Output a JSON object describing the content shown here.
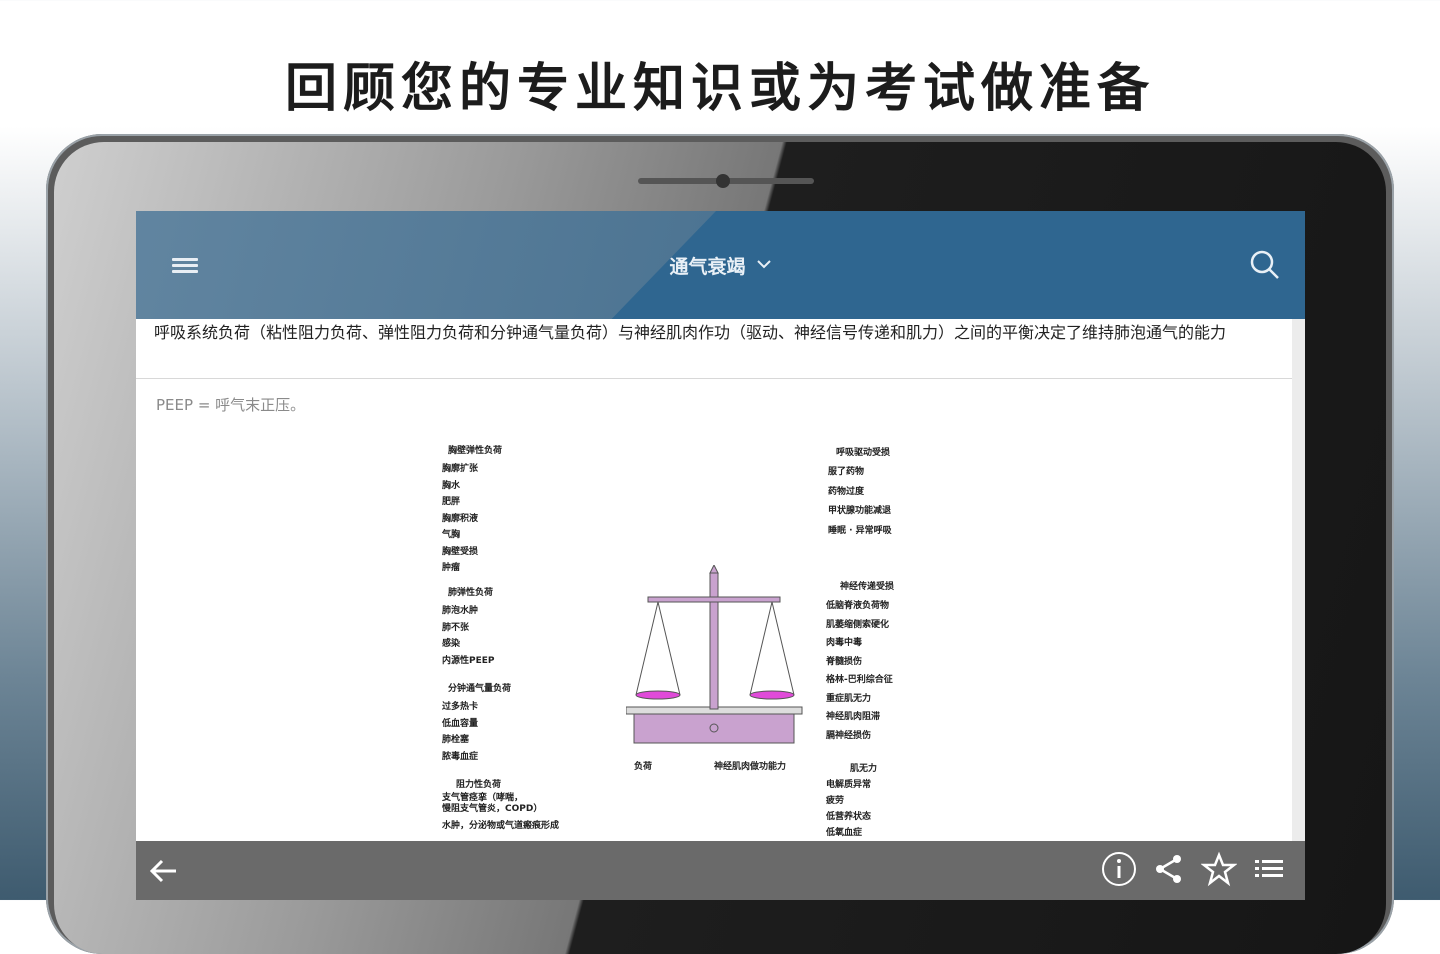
{
  "headline": "回顾您的专业知识或为考试做准备",
  "appbar": {
    "title": "通气衰竭",
    "menu_icon": "hamburger-menu-icon",
    "search_icon": "search-icon"
  },
  "summary": {
    "text": "呼吸系统负荷（粘性阻力负荷、弹性阻力负荷和分钟通气量负荷）与神经肌肉作功（驱动、神经信号传递和肌力）之间的平衡决定了维持肺泡通气的能力"
  },
  "note": "PEEP = 呼气末正压。",
  "figure": {
    "left_groups": [
      {
        "title": "胸壁弹性负荷",
        "items": [
          "胸廓扩张",
          "胸水",
          "肥胖",
          "胸廓积液",
          "气胸",
          "胸壁受损",
          "肿瘤"
        ]
      },
      {
        "title": "肺弹性负荷",
        "items": [
          "肺泡水肿",
          "肺不张",
          "感染",
          "内源性PEEP"
        ]
      },
      {
        "title": "分钟通气量负荷",
        "items": [
          "过多热卡",
          "低血容量",
          "肺栓塞",
          "脓毒血症"
        ]
      },
      {
        "title": "阻力性负荷",
        "items": [
          "支气管痉挛（哮喘，",
          "慢阻支气管炎，COPD）",
          "水肿，分泌物或气道瘢痕形成"
        ]
      }
    ],
    "right_groups": [
      {
        "title": "呼吸驱动受损",
        "items": [
          "服了药物",
          "药物过度",
          "甲状腺功能减退",
          "睡眠 · 异常呼吸"
        ]
      },
      {
        "title": "神经传递受损",
        "items": [
          "低脑脊液负荷物",
          "肌萎缩侧索硬化",
          "肉毒中毒",
          "脊髓损伤",
          "格林-巴利综合征",
          "重症肌无力",
          "神经肌肉阻滞",
          "膈神经损伤"
        ]
      },
      {
        "title": "肌无力",
        "items": [
          "电解质异常",
          "疲劳",
          "低营养状态",
          "低氧血症"
        ]
      }
    ],
    "scale_left_label": "负荷",
    "scale_right_label": "神经肌肉做功能力"
  },
  "bottombar": {
    "back_icon": "arrow-left-icon",
    "icons": [
      "info-icon",
      "share-icon",
      "star-icon",
      "list-icon"
    ]
  },
  "colors": {
    "appbar": "#2f6690",
    "bottombar": "#6a6a6a",
    "scale": "#c9a2cf",
    "scale_pan": "#e04ad9"
  }
}
